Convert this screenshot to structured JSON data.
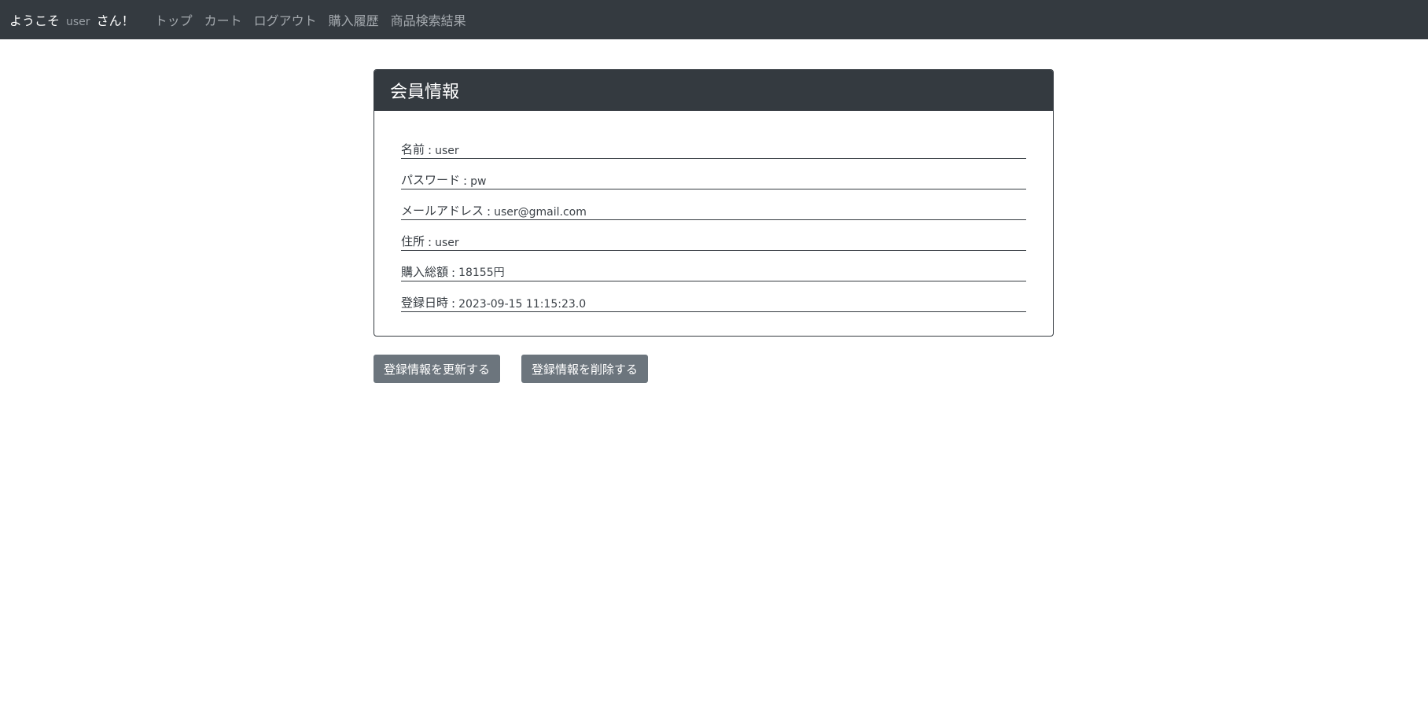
{
  "navbar": {
    "welcome_prefix": "ようこそ",
    "username": "user",
    "welcome_suffix": "さん！",
    "links": [
      "トップ",
      "カート",
      "ログアウト",
      "購入履歴",
      "商品検索結果"
    ]
  },
  "card": {
    "title": "会員情報",
    "fields": [
      {
        "label": "名前",
        "value": "user"
      },
      {
        "label": "パスワード",
        "value": "pw"
      },
      {
        "label": "メールアドレス",
        "value": "user@gmail.com"
      },
      {
        "label": "住所",
        "value": "user"
      },
      {
        "label": "購入総額",
        "value": "18155円"
      },
      {
        "label": "登録日時",
        "value": "2023-09-15 11:15:23.0"
      }
    ]
  },
  "buttons": {
    "update_label": "登録情報を更新する",
    "delete_label": "登録情報を削除する"
  },
  "colors": {
    "navbar_bg": "#343a40",
    "button_bg": "#6c757d"
  }
}
